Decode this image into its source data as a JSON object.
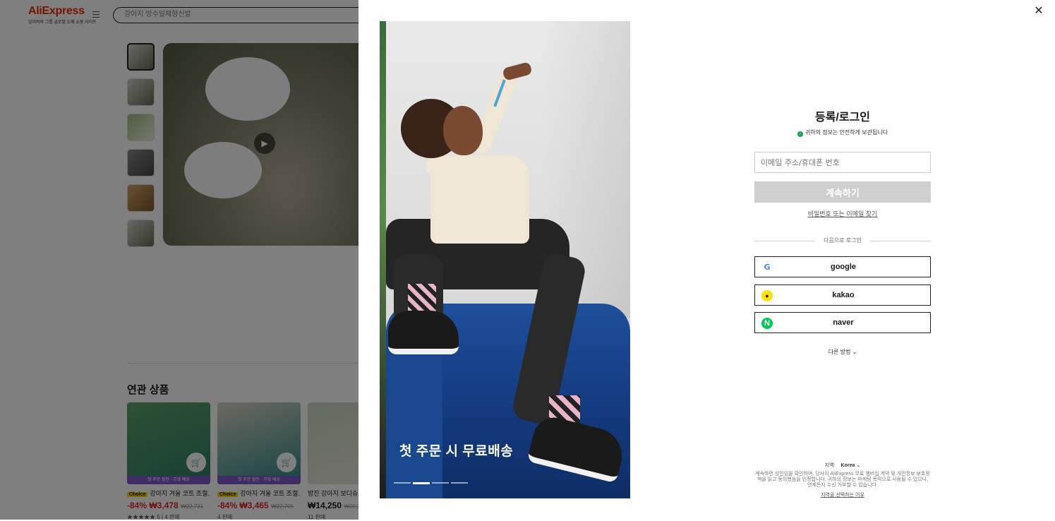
{
  "background": {
    "logo": {
      "brand": "AliExpress",
      "tagline": "알리바바 그룹 글로벌 도매 쇼핑 사이트"
    },
    "search": {
      "placeholder": "강아지 방수일체형신발"
    },
    "product": {
      "play_symbol": "▶"
    },
    "related": {
      "title": "연관 상품",
      "cards": [
        {
          "strip": "첫 주문 할인 · 무료 배송",
          "choice": "Choice",
          "name": "강아지 겨울 코트 조절...",
          "discount": "-84%",
          "price": "₩3,478",
          "old_price": "₩22,731",
          "sold": "★★★★★ 5 | 4 판매"
        },
        {
          "strip": "첫 주문 할인 · 무료 배송",
          "choice": "Choice",
          "name": "강아지 겨울 코트 조절...",
          "discount": "-84%",
          "price": "₩3,465",
          "old_price": "₩22,705",
          "sold": "4 판매"
        },
        {
          "name": "방진 강아지 보디슈트",
          "price": "₩14,250",
          "old_price": "₩20,3",
          "sold": "11 판매"
        }
      ]
    }
  },
  "modal": {
    "close_label": "✕",
    "promo": {
      "headline": "첫 주문 시 무료배송",
      "slides": 4,
      "active_slide": 2
    },
    "login": {
      "title": "등록/로그인",
      "secure_note": "귀하의 정보는 안전하게 보관됩니다",
      "email_placeholder": "이메일 주소/휴대폰 번호",
      "continue_label": "계속하기",
      "find_link": "비밀번호 또는 이메일 찾기",
      "or_label": "다음으로 로그인",
      "providers": [
        {
          "label": "google",
          "icon": "G"
        },
        {
          "label": "kakao",
          "icon": "●"
        },
        {
          "label": "naver",
          "icon": "N"
        }
      ],
      "more_label": "다른 방법",
      "region_label": "지역:",
      "region_value": "Korea",
      "terms_text": "계속하면 성인임을 확인하며, 당사의 AliExpress 무료 멤버십 계약 및 개인정보 보호정책을 읽고 동의했음을 인정합니다. 귀하의 정보는 마케팅 목적으로 사용될 수 있으나, 언제든지 수신 거부할 수 있습니다.",
      "why_region": "지역을 선택하는 이유"
    }
  },
  "colors": {
    "brand": "#e62e04",
    "discount": "#e02828",
    "button_disabled": "#cfcfcf",
    "secure": "#19a04f"
  }
}
